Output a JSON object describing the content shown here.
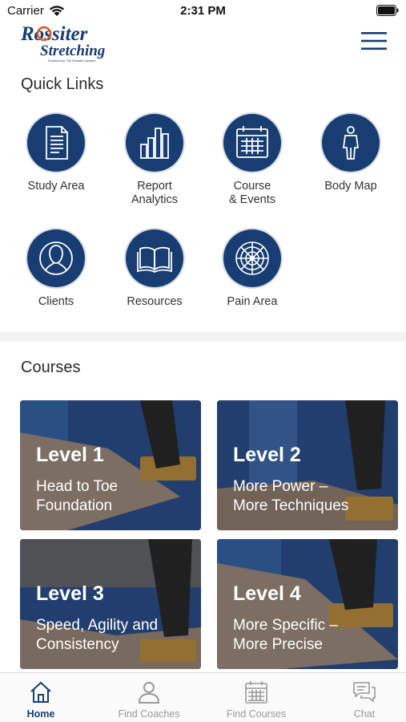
{
  "status_bar": {
    "carrier": "Carrier",
    "time": "2:31 PM"
  },
  "header": {
    "logo_line1": "Rossiter",
    "logo_line2": "Stretching",
    "logo_tagline": "Powered by The Rossiter System",
    "menu_icon": "hamburger-menu-icon"
  },
  "quick_links": {
    "title": "Quick Links",
    "items": [
      {
        "label": "Study Area",
        "icon": "document-icon"
      },
      {
        "label": "Report\nAnalytics",
        "icon": "bar-chart-icon"
      },
      {
        "label": "Course\n& Events",
        "icon": "calendar-icon"
      },
      {
        "label": "Body Map",
        "icon": "human-figure-icon"
      },
      {
        "label": "Clients",
        "icon": "person-icon"
      },
      {
        "label": "Resources",
        "icon": "open-book-icon"
      },
      {
        "label": "Pain Area",
        "icon": "target-icon"
      }
    ]
  },
  "courses": {
    "title": "Courses",
    "items": [
      {
        "level": "Level 1",
        "description": "Head to Toe\nFoundation"
      },
      {
        "level": "Level 2",
        "description": "More Power –\nMore Techniques"
      },
      {
        "level": "Level 3",
        "description": "Speed, Agility and\nConsistency"
      },
      {
        "level": "Level 4",
        "description": "More Specific –\nMore Precise"
      }
    ]
  },
  "tab_bar": {
    "tabs": [
      {
        "label": "Home",
        "icon": "home-icon",
        "active": true
      },
      {
        "label": "Find Coaches",
        "icon": "person-icon",
        "active": false
      },
      {
        "label": "Find Courses",
        "icon": "calendar-icon",
        "active": false
      },
      {
        "label": "Chat",
        "icon": "chat-bubbles-icon",
        "active": false
      }
    ]
  },
  "colors": {
    "brand_navy": "#173d72",
    "logo_orange": "#e0562a",
    "course_blue": "#1e4fa0",
    "tab_inactive": "#9a9a9a"
  }
}
